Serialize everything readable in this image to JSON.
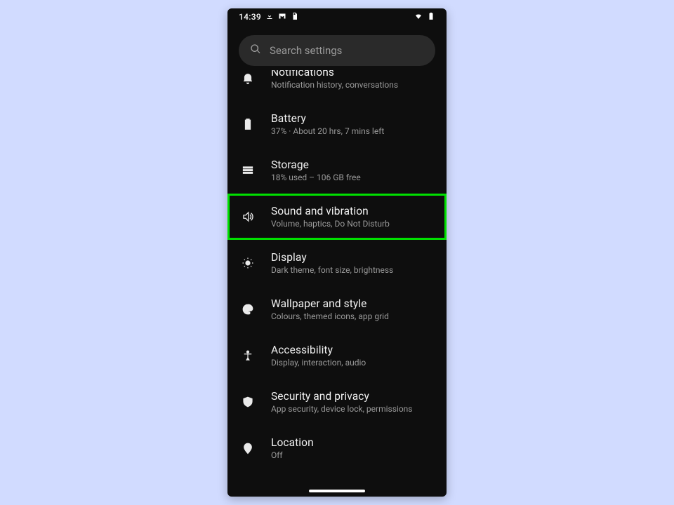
{
  "statusbar": {
    "time": "14:39"
  },
  "search": {
    "placeholder": "Search settings"
  },
  "items": [
    {
      "id": "notifications",
      "title": "Notifications",
      "subtitle": "Notification history, conversations",
      "highlight": false
    },
    {
      "id": "battery",
      "title": "Battery",
      "subtitle": "37% · About 20 hrs, 7 mins left",
      "highlight": false
    },
    {
      "id": "storage",
      "title": "Storage",
      "subtitle": "18% used – 106 GB free",
      "highlight": false
    },
    {
      "id": "sound",
      "title": "Sound and vibration",
      "subtitle": "Volume, haptics, Do Not Disturb",
      "highlight": true
    },
    {
      "id": "display",
      "title": "Display",
      "subtitle": "Dark theme, font size, brightness",
      "highlight": false
    },
    {
      "id": "wallpaper",
      "title": "Wallpaper and style",
      "subtitle": "Colours, themed icons, app grid",
      "highlight": false
    },
    {
      "id": "accessibility",
      "title": "Accessibility",
      "subtitle": "Display, interaction, audio",
      "highlight": false
    },
    {
      "id": "security",
      "title": "Security and privacy",
      "subtitle": "App security, device lock, permissions",
      "highlight": false
    },
    {
      "id": "location",
      "title": "Location",
      "subtitle": "Off",
      "highlight": false
    }
  ]
}
